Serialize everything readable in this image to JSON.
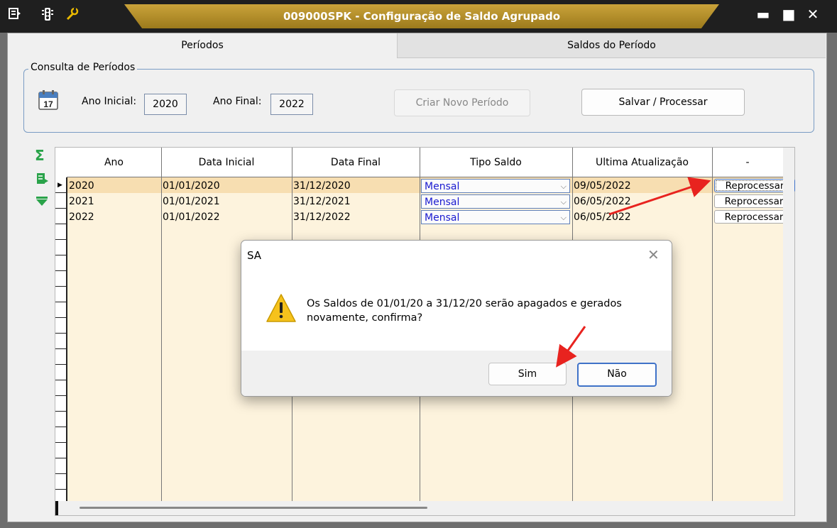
{
  "window": {
    "title": "009000SPK - Configuração de Saldo Agrupado",
    "left_icons": [
      "menu-icon",
      "traffic-light-icon",
      "wrench-icon"
    ],
    "controls": {
      "minimize": "▬",
      "maximize": "■",
      "close": "✕"
    }
  },
  "tabs": [
    {
      "label": "Períodos",
      "active": true
    },
    {
      "label": "Saldos do Período",
      "active": false
    }
  ],
  "consulta": {
    "legend": "Consulta de Períodos",
    "calendar_day": "17",
    "ano_inicial_label": "Ano Inicial:",
    "ano_inicial_value": "2020",
    "ano_final_label": "Ano Final:",
    "ano_final_value": "2022",
    "criar_label": "Criar Novo Período",
    "salvar_label": "Salvar / Processar"
  },
  "side_icons": {
    "sum": "Σ",
    "export": "⇛",
    "filter": "⧗"
  },
  "grid": {
    "columns": [
      "Ano",
      "Data Inicial",
      "Data Final",
      "Tipo Saldo",
      "Ultima Atualização",
      "-"
    ],
    "rows": [
      {
        "ano": "2020",
        "data_inicial": "01/01/2020",
        "data_final": "31/12/2020",
        "tipo_saldo": "Mensal",
        "ultima_atualizacao": "09/05/2022",
        "action": "Reprocessar"
      },
      {
        "ano": "2021",
        "data_inicial": "01/01/2021",
        "data_final": "31/12/2021",
        "tipo_saldo": "Mensal",
        "ultima_atualizacao": "06/05/2022",
        "action": "Reprocessar"
      },
      {
        "ano": "2022",
        "data_inicial": "01/01/2022",
        "data_final": "31/12/2022",
        "tipo_saldo": "Mensal",
        "ultima_atualizacao": "06/05/2022",
        "action": "Reprocessar"
      }
    ],
    "selected_row_color": "#f7deb1",
    "background_color": "#fdf3dd"
  },
  "dialog": {
    "title": "SA",
    "close_glyph": "✕",
    "icon": "warning-icon",
    "message_line1": "Os Saldos de 01/01/20 a 31/12/20 serão apagados e gerados",
    "message_line2": "novamente, confirma?",
    "yes_label": "Sim",
    "no_label": "Não"
  },
  "annotation_color": "#e8231f"
}
